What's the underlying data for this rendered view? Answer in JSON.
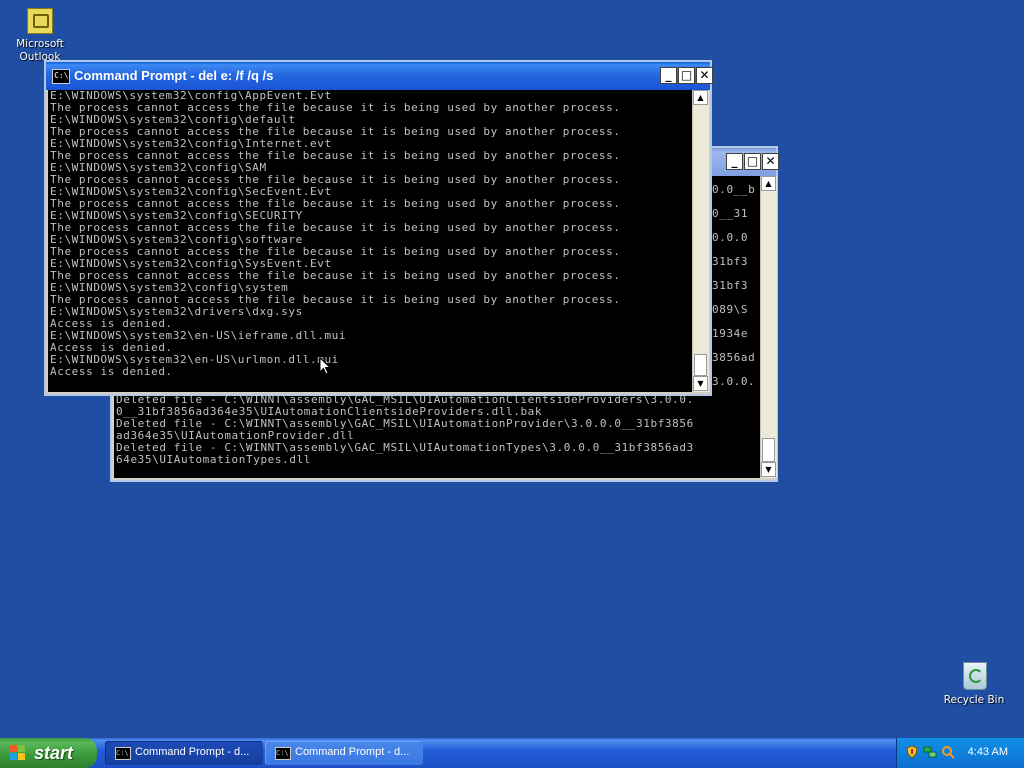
{
  "desktop": {
    "icons": [
      {
        "label": "Microsoft Outlook"
      },
      {
        "label": "Recycle Bin"
      }
    ]
  },
  "front_window": {
    "title": "Command Prompt - del e: /f /q /s",
    "lines": [
      "E:\\WINDOWS\\system32\\config\\AppEvent.Evt",
      "The process cannot access the file because it is being used by another process.",
      "E:\\WINDOWS\\system32\\config\\default",
      "The process cannot access the file because it is being used by another process.",
      "E:\\WINDOWS\\system32\\config\\Internet.evt",
      "The process cannot access the file because it is being used by another process.",
      "E:\\WINDOWS\\system32\\config\\SAM",
      "The process cannot access the file because it is being used by another process.",
      "E:\\WINDOWS\\system32\\config\\SecEvent.Evt",
      "The process cannot access the file because it is being used by another process.",
      "E:\\WINDOWS\\system32\\config\\SECURITY",
      "The process cannot access the file because it is being used by another process.",
      "E:\\WINDOWS\\system32\\config\\software",
      "The process cannot access the file because it is being used by another process.",
      "E:\\WINDOWS\\system32\\config\\SysEvent.Evt",
      "The process cannot access the file because it is being used by another process.",
      "E:\\WINDOWS\\system32\\config\\system",
      "The process cannot access the file because it is being used by another process.",
      "E:\\WINDOWS\\system32\\drivers\\dxg.sys",
      "Access is denied.",
      "E:\\WINDOWS\\system32\\en-US\\ieframe.dll.mui",
      "Access is denied.",
      "E:\\WINDOWS\\system32\\en-US\\urlmon.dll.mui",
      "Access is denied."
    ]
  },
  "back_window": {
    "visible_right_fragments": [
      "0.0__b",
      "0__31",
      "0.0.0",
      "31bf3",
      "31bf3",
      "089\\S",
      "1934e",
      "3856ad",
      "3.0.0."
    ],
    "bottom_lines": [
      "Deleted file - C:\\WINNT\\assembly\\GAC_MSIL\\UIAutomationClientsideProviders\\3.0.0.",
      "0__31bf3856ad364e35\\UIAutomationClientsideProviders.dll.bak",
      "Deleted file - C:\\WINNT\\assembly\\GAC_MSIL\\UIAutomationProvider\\3.0.0.0__31bf3856",
      "ad364e35\\UIAutomationProvider.dll",
      "Deleted file - C:\\WINNT\\assembly\\GAC_MSIL\\UIAutomationTypes\\3.0.0.0__31bf3856ad3",
      "64e35\\UIAutomationTypes.dll"
    ]
  },
  "taskbar": {
    "start_label": "start",
    "tasks": [
      {
        "label": "Command Prompt - d..."
      },
      {
        "label": "Command Prompt - d..."
      }
    ],
    "clock": "4:43 AM"
  }
}
